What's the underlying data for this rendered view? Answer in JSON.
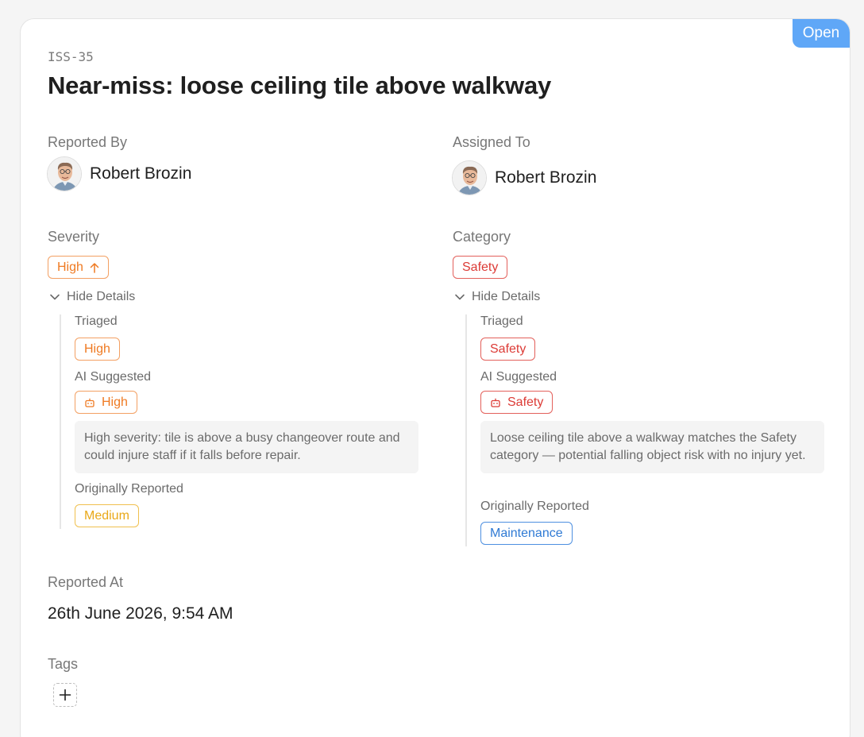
{
  "issue": {
    "id": "ISS-35",
    "title": "Near-miss: loose ceiling tile above walkway",
    "status": "Open"
  },
  "reported_by": {
    "label": "Reported By",
    "name": "Robert Brozin"
  },
  "assigned_to": {
    "label": "Assigned To",
    "name": "Robert Brozin"
  },
  "severity": {
    "label": "Severity",
    "value": "High",
    "toggle_label": "Hide Details",
    "triaged_label": "Triaged",
    "triaged_value": "High",
    "ai_label": "AI Suggested",
    "ai_value": "High",
    "ai_reason": "High severity: tile is above a busy changeover route and could injure staff if it falls before repair.",
    "original_label": "Originally Reported",
    "original_value": "Medium"
  },
  "category": {
    "label": "Category",
    "value": "Safety",
    "toggle_label": "Hide Details",
    "triaged_label": "Triaged",
    "triaged_value": "Safety",
    "ai_label": "AI Suggested",
    "ai_value": "Safety",
    "ai_reason": "Loose ceiling tile above a walkway matches the Safety category — potential falling object risk with no injury yet.",
    "original_label": "Originally Reported",
    "original_value": "Maintenance"
  },
  "reported_at": {
    "label": "Reported At",
    "value": "26th June 2026, 9:54 AM"
  },
  "tags": {
    "label": "Tags",
    "add_icon": "plus-icon"
  },
  "colors": {
    "status_blue": "#5fa7f7",
    "high_orange": "#ef7a22",
    "safety_red": "#dc3b36",
    "medium_yellow": "#e9a818",
    "maintenance_blue": "#2f7ad4"
  }
}
